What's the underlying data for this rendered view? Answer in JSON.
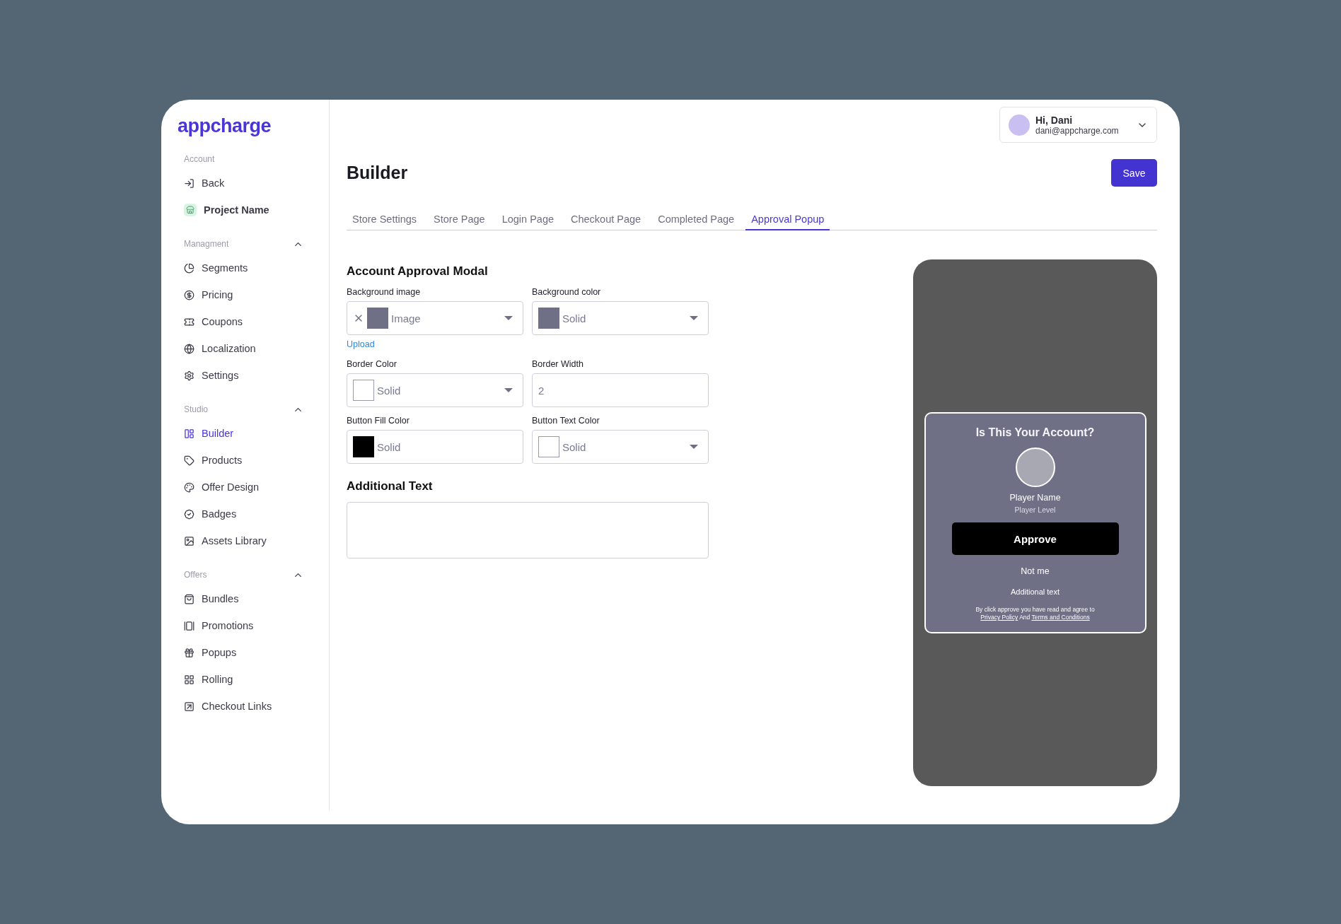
{
  "logo": "appcharge",
  "sidebar": {
    "sections": [
      {
        "title": "Account",
        "items": [
          {
            "label": "Back",
            "kind": "link",
            "selected": false
          },
          {
            "label": "Project Name",
            "kind": "project",
            "selected": false
          }
        ]
      },
      {
        "title": "Managment",
        "expanded": true,
        "items": [
          {
            "label": "Segments",
            "kind": "link",
            "selected": false
          },
          {
            "label": "Pricing",
            "kind": "link",
            "selected": false
          },
          {
            "label": "Coupons",
            "kind": "link",
            "selected": false
          },
          {
            "label": "Localization",
            "kind": "link",
            "selected": false
          },
          {
            "label": "Settings",
            "kind": "link",
            "selected": false
          }
        ]
      },
      {
        "title": "Studio",
        "expanded": true,
        "items": [
          {
            "label": "Builder",
            "kind": "link",
            "selected": true
          },
          {
            "label": "Products",
            "kind": "link",
            "selected": false
          },
          {
            "label": "Offer Design",
            "kind": "link",
            "selected": false
          },
          {
            "label": "Badges",
            "kind": "link",
            "selected": false
          },
          {
            "label": "Assets Library",
            "kind": "link",
            "selected": false
          }
        ]
      },
      {
        "title": "Offers",
        "expanded": true,
        "items": [
          {
            "label": "Bundles",
            "kind": "link",
            "selected": false
          },
          {
            "label": "Promotions",
            "kind": "link",
            "selected": false
          },
          {
            "label": "Popups",
            "kind": "link",
            "selected": false
          },
          {
            "label": "Rolling",
            "kind": "link",
            "selected": false
          },
          {
            "label": "Checkout Links",
            "kind": "link",
            "selected": false
          }
        ]
      }
    ]
  },
  "user": {
    "greeting": "Hi, Dani",
    "email": "dani@appcharge.com"
  },
  "page_title": "Builder",
  "save_button": "Save",
  "tabs": [
    {
      "label": "Store Settings",
      "selected": false
    },
    {
      "label": "Store Page",
      "selected": false
    },
    {
      "label": "Login Page",
      "selected": false
    },
    {
      "label": "Checkout Page",
      "selected": false
    },
    {
      "label": "Completed Page",
      "selected": false
    },
    {
      "label": "Approval Popup",
      "selected": true
    }
  ],
  "form": {
    "title": "Account Approval Modal",
    "fields": [
      {
        "label": "Background image",
        "kind": "select",
        "value": "Image",
        "color": "#6f6f86",
        "clearable": true,
        "arrow": true
      },
      {
        "label": "Background color",
        "kind": "select",
        "value": "Solid",
        "color": "#6f6f86",
        "clearable": false,
        "arrow": true
      },
      {
        "label": "Border Color",
        "kind": "select",
        "value": "Solid",
        "color": "#ffffff",
        "clearable": false,
        "arrow": true
      },
      {
        "label": "Border Width",
        "kind": "text",
        "value": "2"
      },
      {
        "label": "Button Fill Color",
        "kind": "select",
        "value": "Solid",
        "color": "#000000",
        "clearable": false,
        "arrow": false
      },
      {
        "label": "Button Text Color",
        "kind": "select",
        "value": "Solid",
        "color": "#ffffff",
        "clearable": false,
        "arrow": true
      }
    ],
    "upload_link": "Upload",
    "additional_title": "Additional Text"
  },
  "preview": {
    "title": "Is This Your Account?",
    "player_name": "Player Name",
    "player_level": "Player Level",
    "approve": "Approve",
    "not_me": "Not me",
    "additional_text": "Additional text",
    "legal_before": "By click approve you have read and agree to",
    "privacy_link": "Privacy Policy",
    "legal_middle": "And",
    "terms_link": "Terms and Conditions"
  }
}
